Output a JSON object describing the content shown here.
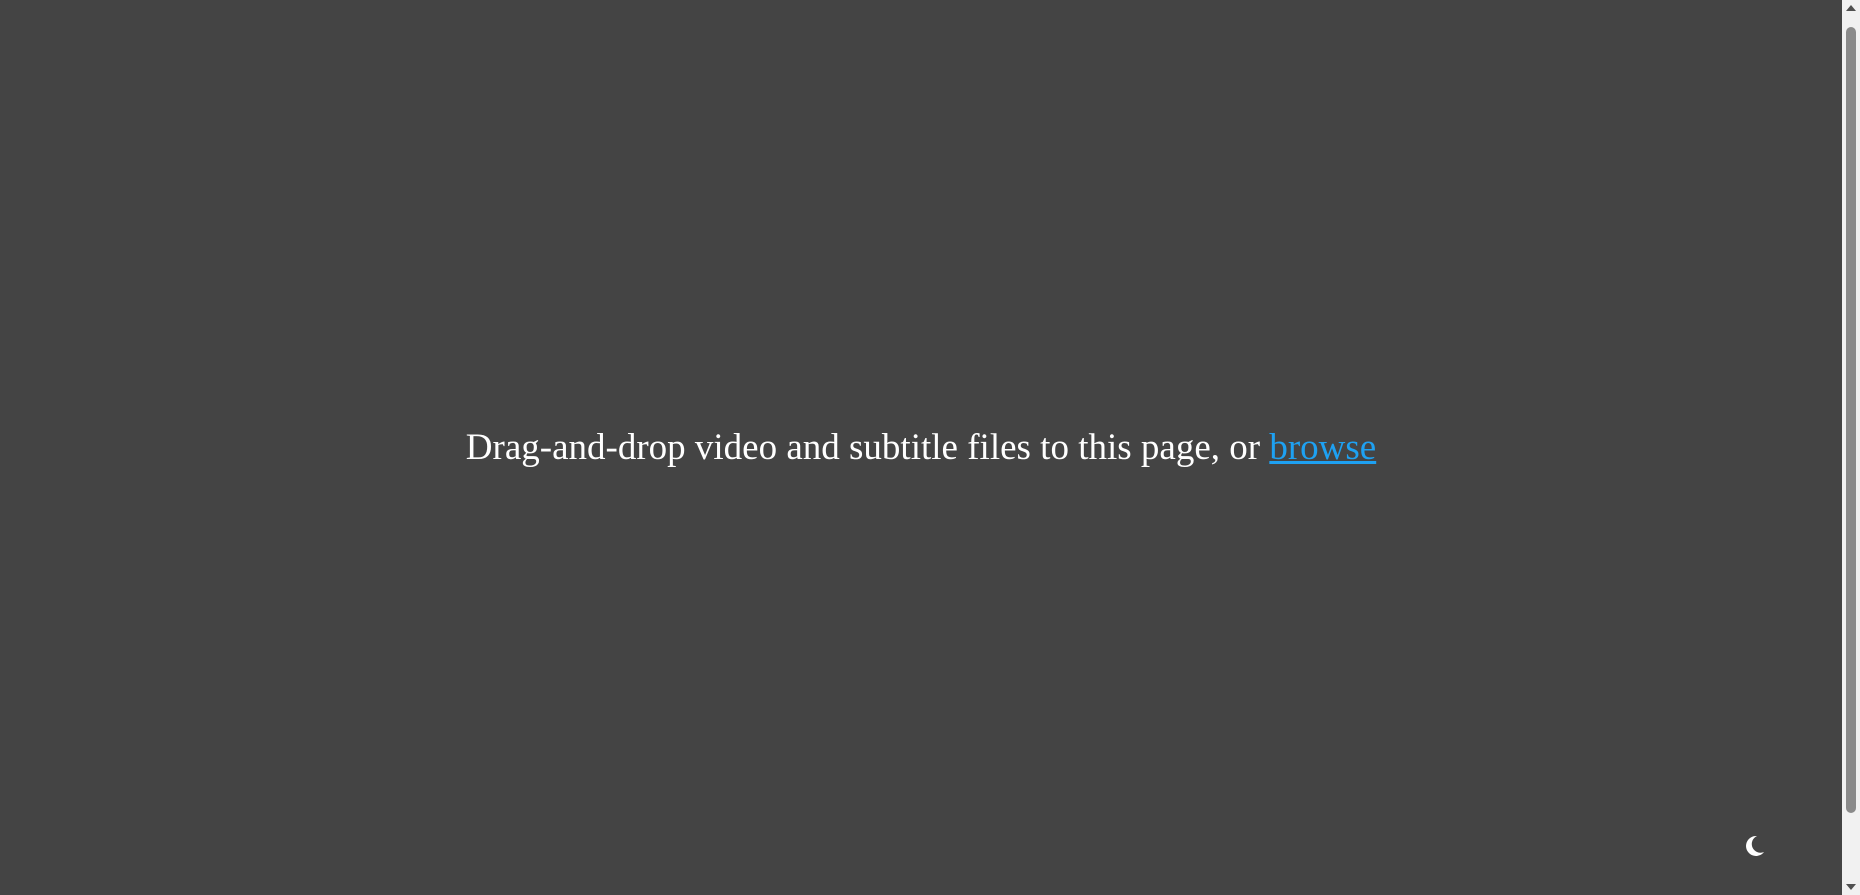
{
  "drop_zone": {
    "message": "Drag-and-drop video and subtitle files to this page, or ",
    "browse_label": "browse"
  },
  "theme_toggle": {
    "icon": "moon-icon"
  },
  "colors": {
    "background": "#444444",
    "text": "#ffffff",
    "link": "#1ea1f2",
    "scrollbar_track": "#f1f1f1",
    "scrollbar_thumb": "#8a8a8a"
  }
}
